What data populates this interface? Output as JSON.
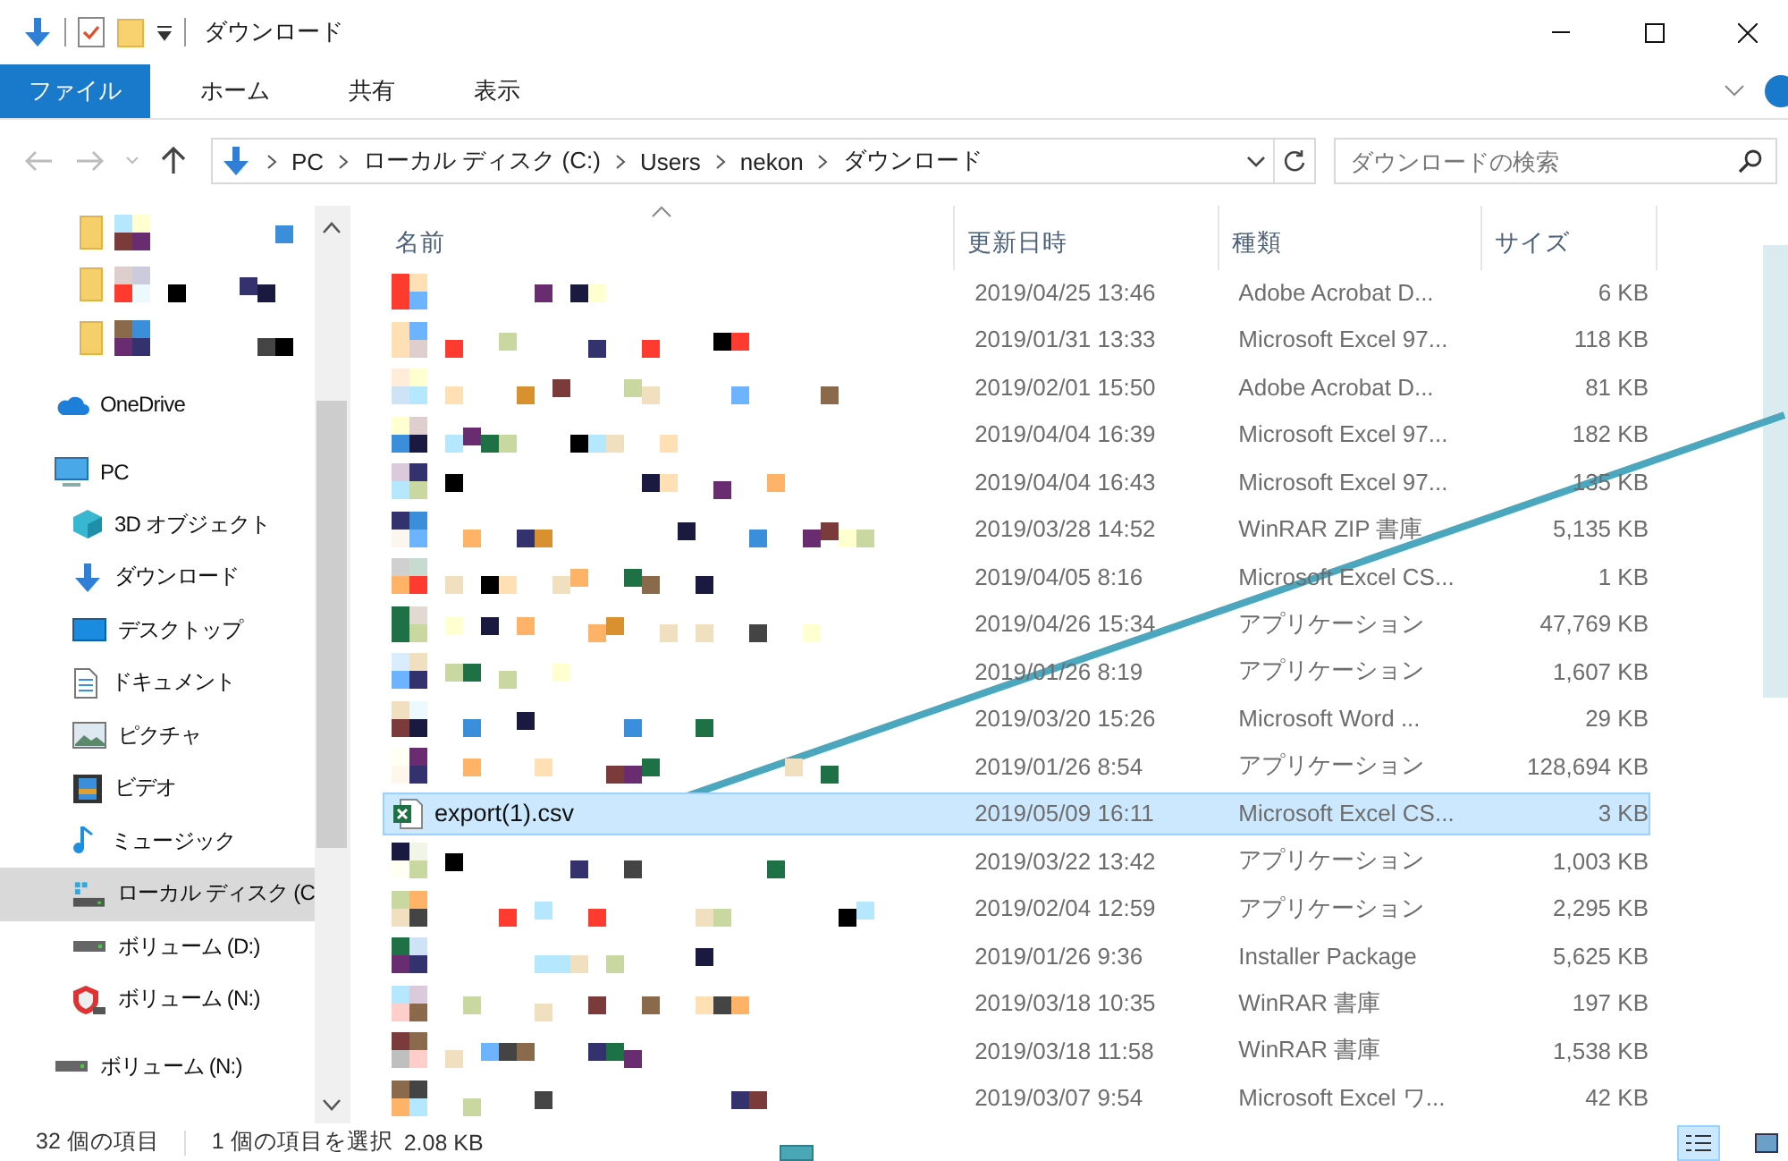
{
  "window": {
    "title": "ダウンロード"
  },
  "ribbon": {
    "tabs": [
      {
        "label": "ファイル",
        "kind": "file"
      },
      {
        "label": "ホーム",
        "kind": "tab"
      },
      {
        "label": "共有",
        "kind": "tab"
      },
      {
        "label": "表示",
        "kind": "tab"
      }
    ]
  },
  "address": {
    "path": [
      "PC",
      "ローカル ディスク (C:)",
      "Users",
      "nekon",
      "ダウンロード"
    ]
  },
  "search": {
    "placeholder": "ダウンロードの検索"
  },
  "sidebar": {
    "items": [
      {
        "kind": "mosaic",
        "selected": false
      },
      {
        "kind": "mosaic",
        "selected": false
      },
      {
        "kind": "mosaic",
        "selected": false
      },
      {
        "kind": "cloud",
        "label": "OneDrive",
        "selected": false
      },
      {
        "kind": "computer",
        "label": "PC",
        "selected": false,
        "children": [
          {
            "kind": "cube",
            "label": "3D オブジェクト",
            "selected": false
          },
          {
            "kind": "download",
            "label": "ダウンロード",
            "selected": false
          },
          {
            "kind": "desktop",
            "label": "デスクトップ",
            "selected": false
          },
          {
            "kind": "document",
            "label": "ドキュメント",
            "selected": false
          },
          {
            "label": "ピクチャ",
            "selected": false
          },
          {
            "kind": "video",
            "label": "ビデオ",
            "selected": false
          },
          {
            "kind": "music",
            "label": "ミュージック",
            "selected": false
          },
          {
            "kind": "disk",
            "label": "ローカル ディスク (C",
            "selected": true
          },
          {
            "kind": "drive",
            "label": "ボリューム (D:)",
            "selected": false
          },
          {
            "kind": "shield",
            "label": "ボリューム (N:)",
            "selected": false
          }
        ]
      },
      {
        "kind": "drive",
        "label": "ボリューム (N:)",
        "selected": false
      }
    ]
  },
  "table": {
    "columns": [
      "名前",
      "更新日時",
      "種類",
      "サイズ"
    ],
    "rows": [
      {
        "kind": "mosaic",
        "selected": false,
        "date": "2019/04/25 13:46",
        "type": "Adobe Acrobat D...",
        "size": "6 KB"
      },
      {
        "kind": "mosaic",
        "selected": false,
        "date": "2019/01/31 13:33",
        "type": "Microsoft Excel 97...",
        "size": "118 KB"
      },
      {
        "kind": "mosaic",
        "selected": false,
        "date": "2019/02/01 15:50",
        "type": "Adobe Acrobat D...",
        "size": "81 KB"
      },
      {
        "kind": "mosaic",
        "selected": false,
        "date": "2019/04/04 16:39",
        "type": "Microsoft Excel 97...",
        "size": "182 KB"
      },
      {
        "kind": "mosaic",
        "selected": false,
        "date": "2019/04/04 16:43",
        "type": "Microsoft Excel 97...",
        "size": "135 KB"
      },
      {
        "kind": "mosaic",
        "selected": false,
        "date": "2019/03/28 14:52",
        "type": "WinRAR ZIP 書庫",
        "size": "5,135 KB"
      },
      {
        "kind": "mosaic",
        "selected": false,
        "date": "2019/04/05 8:16",
        "type": "Microsoft Excel CS...",
        "size": "1 KB"
      },
      {
        "kind": "mosaic",
        "selected": false,
        "date": "2019/04/26 15:34",
        "type": "アプリケーション",
        "size": "47,769 KB"
      },
      {
        "kind": "mosaic",
        "selected": false,
        "date": "2019/01/26 8:19",
        "type": "アプリケーション",
        "size": "1,607 KB"
      },
      {
        "kind": "mosaic",
        "selected": false,
        "date": "2019/03/20 15:26",
        "type": "Microsoft Word ...",
        "size": "29 KB"
      },
      {
        "kind": "mosaic",
        "selected": false,
        "date": "2019/01/26 8:54",
        "type": "アプリケーション",
        "size": "128,694 KB"
      },
      {
        "kind": "file",
        "name": "export(1).csv",
        "selected": true,
        "date": "2019/05/09 16:11",
        "type": "Microsoft Excel CS...",
        "size": "3 KB"
      },
      {
        "kind": "mosaic",
        "selected": false,
        "date": "2019/03/22 13:42",
        "type": "アプリケーション",
        "size": "1,003 KB"
      },
      {
        "kind": "mosaic",
        "selected": false,
        "date": "2019/02/04 12:59",
        "type": "アプリケーション",
        "size": "2,295 KB"
      },
      {
        "kind": "mosaic",
        "selected": false,
        "date": "2019/01/26 9:36",
        "type": "Installer Package",
        "size": "5,625 KB"
      },
      {
        "kind": "mosaic",
        "selected": false,
        "date": "2019/03/18 10:35",
        "type": "WinRAR 書庫",
        "size": "197 KB"
      },
      {
        "kind": "mosaic",
        "selected": false,
        "date": "2019/03/18 11:58",
        "type": "WinRAR 書庫",
        "size": "1,538 KB"
      },
      {
        "kind": "mosaic",
        "selected": false,
        "date": "2019/03/07 9:54",
        "type": "Microsoft Excel ワ...",
        "size": "42 KB"
      }
    ]
  },
  "status_bar": {
    "count": "32 個の項目",
    "selection": "1 個の項目を選択",
    "selection_size": "2.08 KB",
    "views": [
      {
        "kind": "details",
        "selected": true
      },
      {
        "kind": "icons",
        "selected": false
      }
    ]
  }
}
